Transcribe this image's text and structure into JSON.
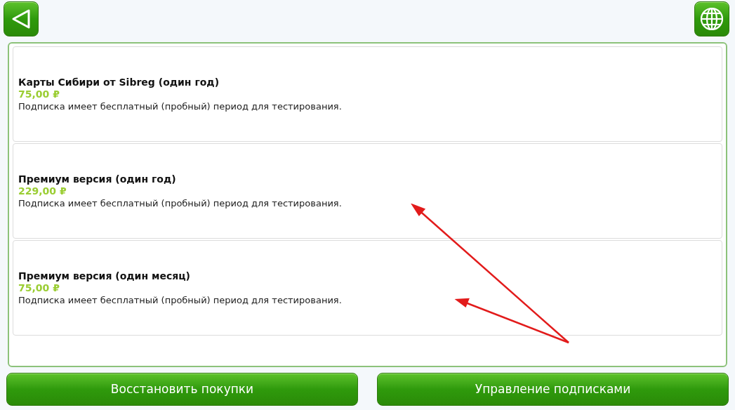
{
  "subscriptions": [
    {
      "title": "Карты Сибири от Sibreg (один год)",
      "price": "75,00 ₽",
      "note": "Подписка имеет бесплатный (пробный) период для тестирования."
    },
    {
      "title": "Премиум версия (один год)",
      "price": "229,00 ₽",
      "note": "Подписка имеет бесплатный (пробный) период для тестирования."
    },
    {
      "title": "Премиум версия (один месяц)",
      "price": "75,00 ₽",
      "note": "Подписка имеет бесплатный (пробный) период для тестирования."
    }
  ],
  "buttons": [
    "Восстановить покупки",
    "Управление подписками"
  ]
}
